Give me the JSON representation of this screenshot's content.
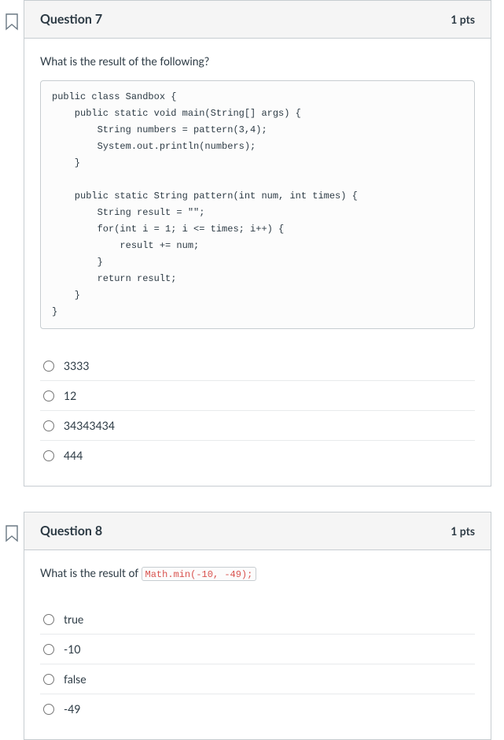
{
  "q7": {
    "title": "Question 7",
    "pts": "1 pts",
    "prompt": "What is the result of the following?",
    "code": "public class Sandbox {\n    public static void main(String[] args) {\n        String numbers = pattern(3,4);\n        System.out.println(numbers);\n    }\n\n    public static String pattern(int num, int times) {\n        String result = \"\";\n        for(int i = 1; i <= times; i++) {\n            result += num;\n        }\n        return result;\n    }\n}",
    "answers": [
      "3333",
      "12",
      "34343434",
      "444"
    ]
  },
  "q8": {
    "title": "Question 8",
    "pts": "1 pts",
    "prompt_prefix": "What is the result of ",
    "inline_code": "Math.min(-10, -49);",
    "answers": [
      "true",
      "-10",
      "false",
      "-49"
    ]
  }
}
